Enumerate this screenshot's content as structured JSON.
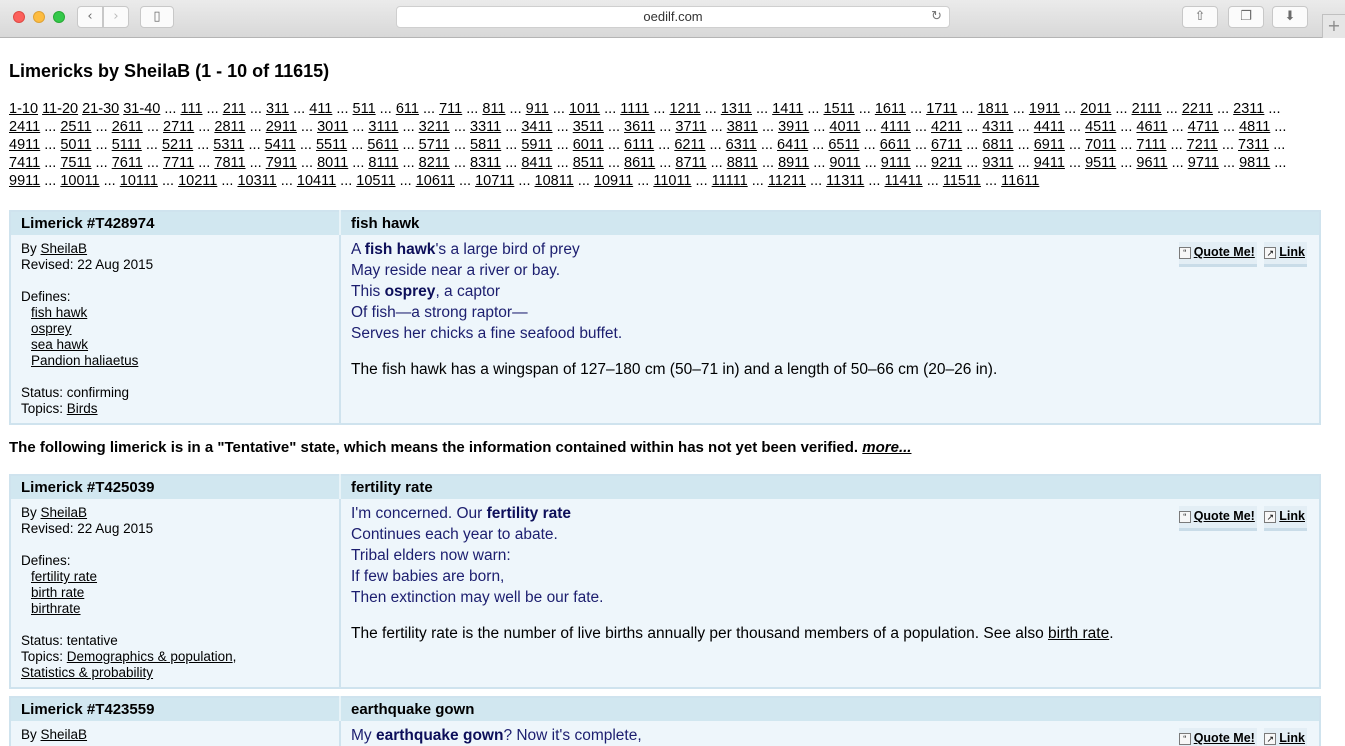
{
  "browser": {
    "url": "oedilf.com",
    "back_icon": "chevron-left-icon",
    "forward_icon": "chevron-right-icon"
  },
  "page": {
    "title": "Limericks by SheilaB (1 - 10 of 11615)",
    "pager_links": [
      "1-10",
      "11-20",
      "21-30",
      "31-40",
      "111",
      "211",
      "311",
      "411",
      "511",
      "611",
      "711",
      "811",
      "911",
      "1011",
      "1111",
      "1211",
      "1311",
      "1411",
      "1511",
      "1611",
      "1711",
      "1811",
      "1911",
      "2011",
      "2111",
      "2211",
      "2311",
      "2411",
      "2511",
      "2611",
      "2711",
      "2811",
      "2911",
      "3011",
      "3111",
      "3211",
      "3311",
      "3411",
      "3511",
      "3611",
      "3711",
      "3811",
      "3911",
      "4011",
      "4111",
      "4211",
      "4311",
      "4411",
      "4511",
      "4611",
      "4711",
      "4811",
      "4911",
      "5011",
      "5111",
      "5211",
      "5311",
      "5411",
      "5511",
      "5611",
      "5711",
      "5811",
      "5911",
      "6011",
      "6111",
      "6211",
      "6311",
      "6411",
      "6511",
      "6611",
      "6711",
      "6811",
      "6911",
      "7011",
      "7111",
      "7211",
      "7311",
      "7411",
      "7511",
      "7611",
      "7711",
      "7811",
      "7911",
      "8011",
      "8111",
      "8211",
      "8311",
      "8411",
      "8511",
      "8611",
      "8711",
      "8811",
      "8911",
      "9011",
      "9111",
      "9211",
      "9311",
      "9411",
      "9511",
      "9611",
      "9711",
      "9811",
      "9911",
      "10011",
      "10111",
      "10211",
      "10311",
      "10411",
      "10511",
      "10611",
      "10711",
      "10811",
      "10911",
      "11011",
      "11111",
      "11211",
      "11311",
      "11411",
      "11511",
      "11611"
    ],
    "tentative_notice": "The following limerick is in a \"Tentative\" state, which means the information contained within has not yet been verified.",
    "tentative_more": "more..."
  },
  "labels": {
    "by": "By ",
    "revised": "Revised: ",
    "defines": "Defines:",
    "status": "Status: ",
    "topics": "Topics: ",
    "quote": "Quote Me!",
    "link": "Link"
  },
  "limericks": [
    {
      "id": "Limerick #T428974",
      "word": "fish hawk",
      "author": "SheilaB",
      "revised": "22 Aug 2015",
      "defines": [
        "fish hawk",
        "osprey",
        "sea hawk",
        "Pandion haliaetus"
      ],
      "status": "confirming",
      "topics": [
        "Birds"
      ],
      "verse": [
        [
          "A ",
          "fish hawk",
          "'s a large bird of prey"
        ],
        [
          "May reside near a river or bay.",
          "",
          ""
        ],
        [
          "This ",
          "osprey",
          ", a captor"
        ],
        [
          "Of fish—a strong raptor—",
          "",
          ""
        ],
        [
          "Serves her chicks a fine seafood buffet.",
          "",
          ""
        ]
      ],
      "note": "The fish hawk has a wingspan of 127–180 cm (50–71 in) and a length of 50–66 cm (20–26 in).",
      "note_link": ""
    },
    {
      "id": "Limerick #T425039",
      "word": "fertility rate",
      "author": "SheilaB",
      "revised": "22 Aug 2015",
      "defines": [
        "fertility rate",
        "birth rate",
        "birthrate"
      ],
      "status": "tentative",
      "topics": [
        "Demographics & population",
        "Statistics & probability"
      ],
      "verse": [
        [
          "I'm concerned. Our ",
          "fertility rate",
          ""
        ],
        [
          "Continues each year to abate.",
          "",
          ""
        ],
        [
          "Tribal elders now warn:",
          "",
          ""
        ],
        [
          "If few babies are born,",
          "",
          ""
        ],
        [
          "Then extinction may well be our fate.",
          "",
          ""
        ]
      ],
      "note": "The fertility rate is the number of live births annually per thousand members of a population. See also ",
      "note_link": "birth rate"
    },
    {
      "id": "Limerick #T423559",
      "word": "earthquake gown",
      "author": "SheilaB",
      "verse_first": [
        "My ",
        "earthquake gown",
        "? Now it's complete,"
      ]
    }
  ]
}
